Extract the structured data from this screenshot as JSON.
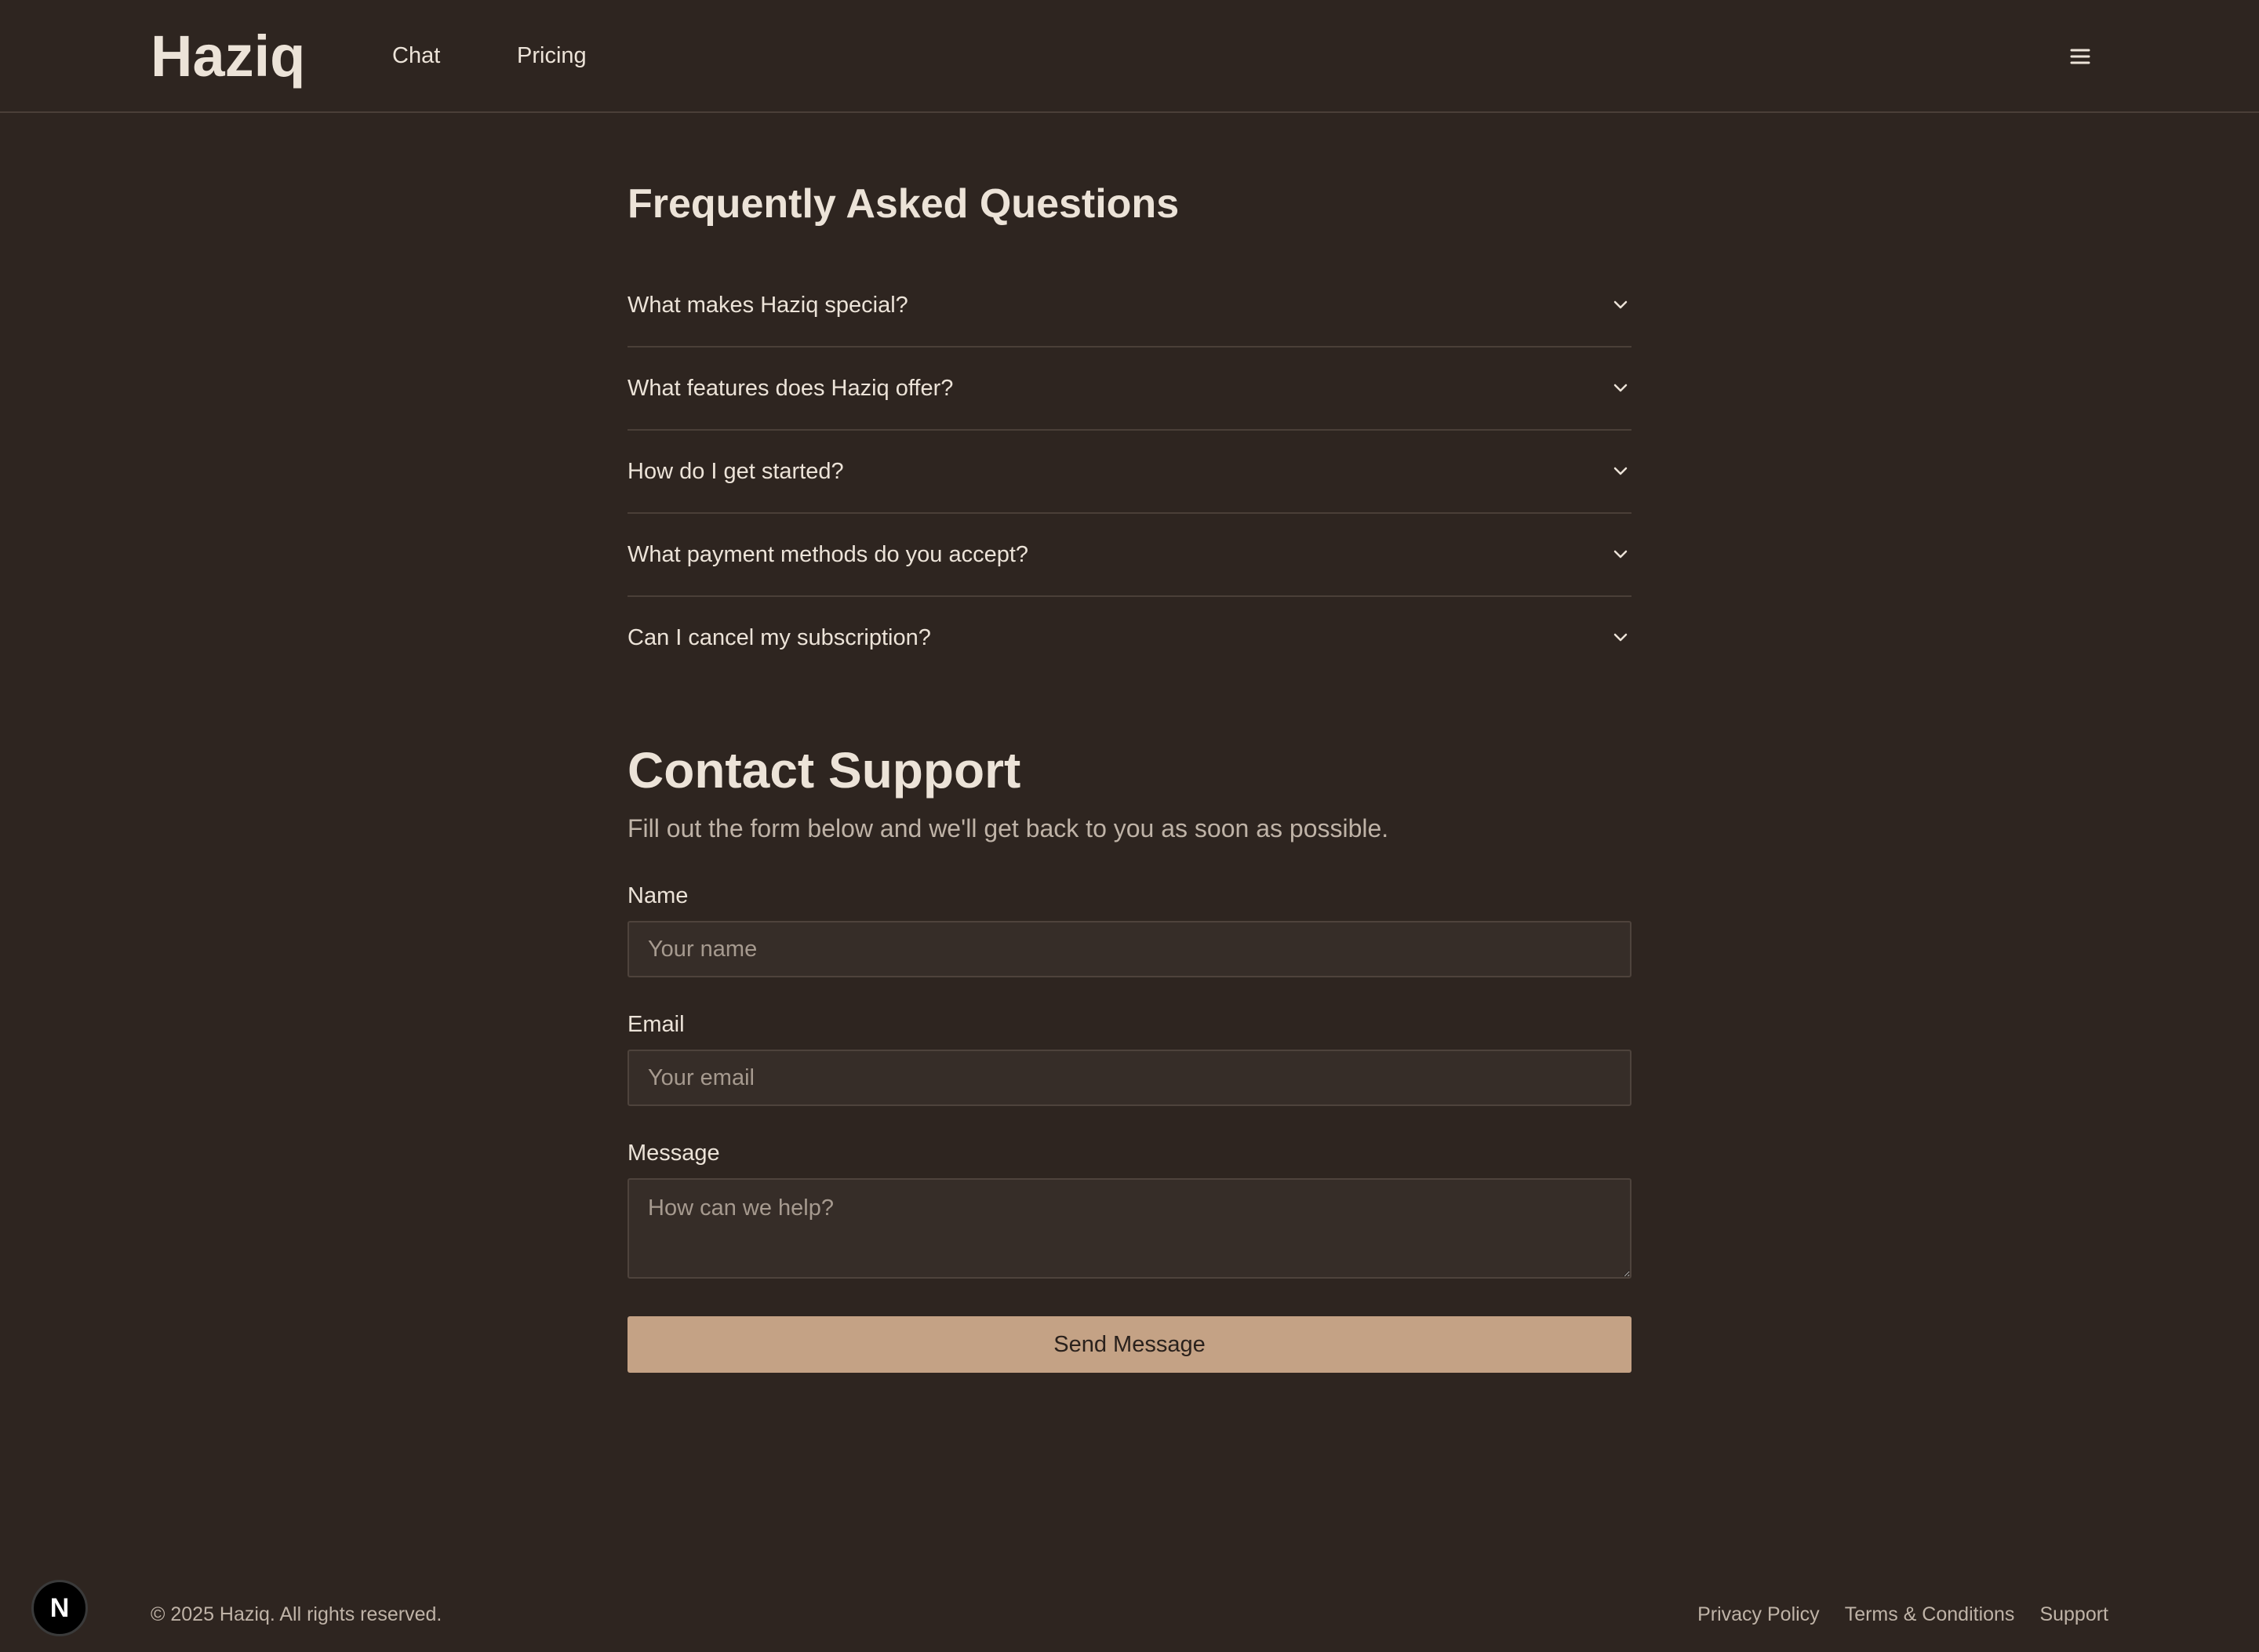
{
  "header": {
    "logo": "Haziq",
    "nav": [
      "Chat",
      "Pricing"
    ],
    "menu_icon": "hamburger-menu-icon"
  },
  "faq": {
    "title": "Frequently Asked Questions",
    "items": [
      {
        "question": "What makes Haziq special?"
      },
      {
        "question": "What features does Haziq offer?"
      },
      {
        "question": "How do I get started?"
      },
      {
        "question": "What payment methods do you accept?"
      },
      {
        "question": "Can I cancel my subscription?"
      }
    ],
    "chevron_icon": "chevron-down-icon"
  },
  "contact": {
    "title": "Contact Support",
    "subtitle": "Fill out the form below and we'll get back to you as soon as possible.",
    "name_label": "Name",
    "name_placeholder": "Your name",
    "name_value": "",
    "email_label": "Email",
    "email_placeholder": "Your email",
    "email_value": "",
    "message_label": "Message",
    "message_placeholder": "How can we help?",
    "message_value": "",
    "submit_label": "Send Message"
  },
  "footer": {
    "copyright": "© 2025 Haziq. All rights reserved.",
    "links": [
      "Privacy Policy",
      "Terms & Conditions",
      "Support"
    ]
  },
  "badge": {
    "letter": "N",
    "icon": "nextjs-logo-icon"
  },
  "colors": {
    "background": "#2e2520",
    "text": "#ece3d8",
    "muted_text": "#bfb3a7",
    "input_background": "#362d28",
    "border": "#4a3f38",
    "accent": "#c4a285"
  }
}
